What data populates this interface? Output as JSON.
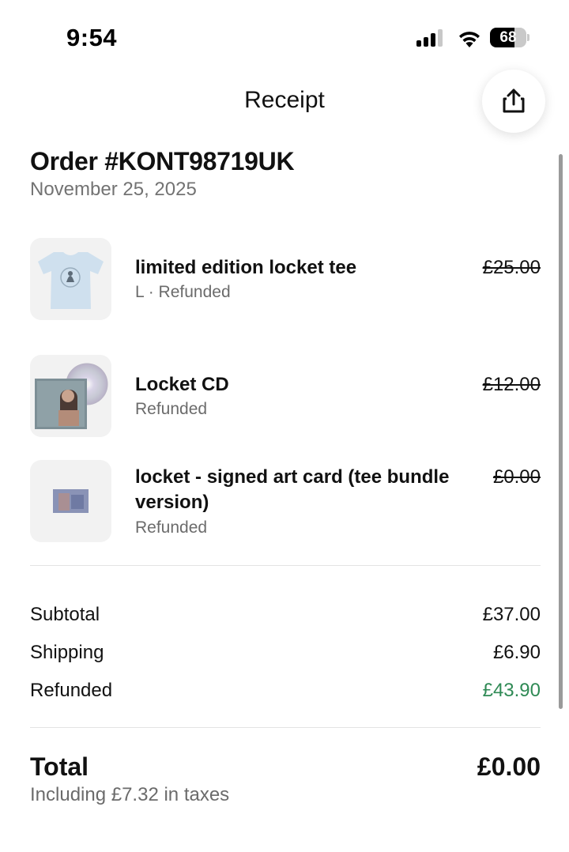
{
  "status_bar": {
    "time": "9:54",
    "battery": "68",
    "battery_level": 0.68,
    "icons": [
      "signal-icon",
      "wifi-icon",
      "battery-icon"
    ]
  },
  "header": {
    "title": "Receipt",
    "share_icon": "share-icon"
  },
  "order": {
    "number": "Order #KONT98719UK",
    "date": "November 25, 2025"
  },
  "items": [
    {
      "name": "limited edition locket tee",
      "subtitle": "L · Refunded",
      "price": "£25.00",
      "thumb": "tee-thumbnail"
    },
    {
      "name": "Locket CD",
      "subtitle": "Refunded",
      "price": "£12.00",
      "thumb": "cd-thumbnail"
    },
    {
      "name_line1": "locket - signed art card (tee bundle",
      "name_line2": "version)",
      "subtitle": "Refunded",
      "price": "£0.00",
      "thumb": "art-card-thumbnail"
    }
  ],
  "summary": {
    "subtotal_label": "Subtotal",
    "subtotal": "£37.00",
    "shipping_label": "Shipping",
    "shipping": "£6.90",
    "refunded_label": "Refunded",
    "refunded": "£43.90"
  },
  "total": {
    "label": "Total",
    "value": "£0.00",
    "tax_note": "Including £7.32 in taxes"
  },
  "colors": {
    "refund_green": "#2f8a55",
    "muted": "#6b6b6b",
    "thumb_bg": "#f2f2f2"
  }
}
